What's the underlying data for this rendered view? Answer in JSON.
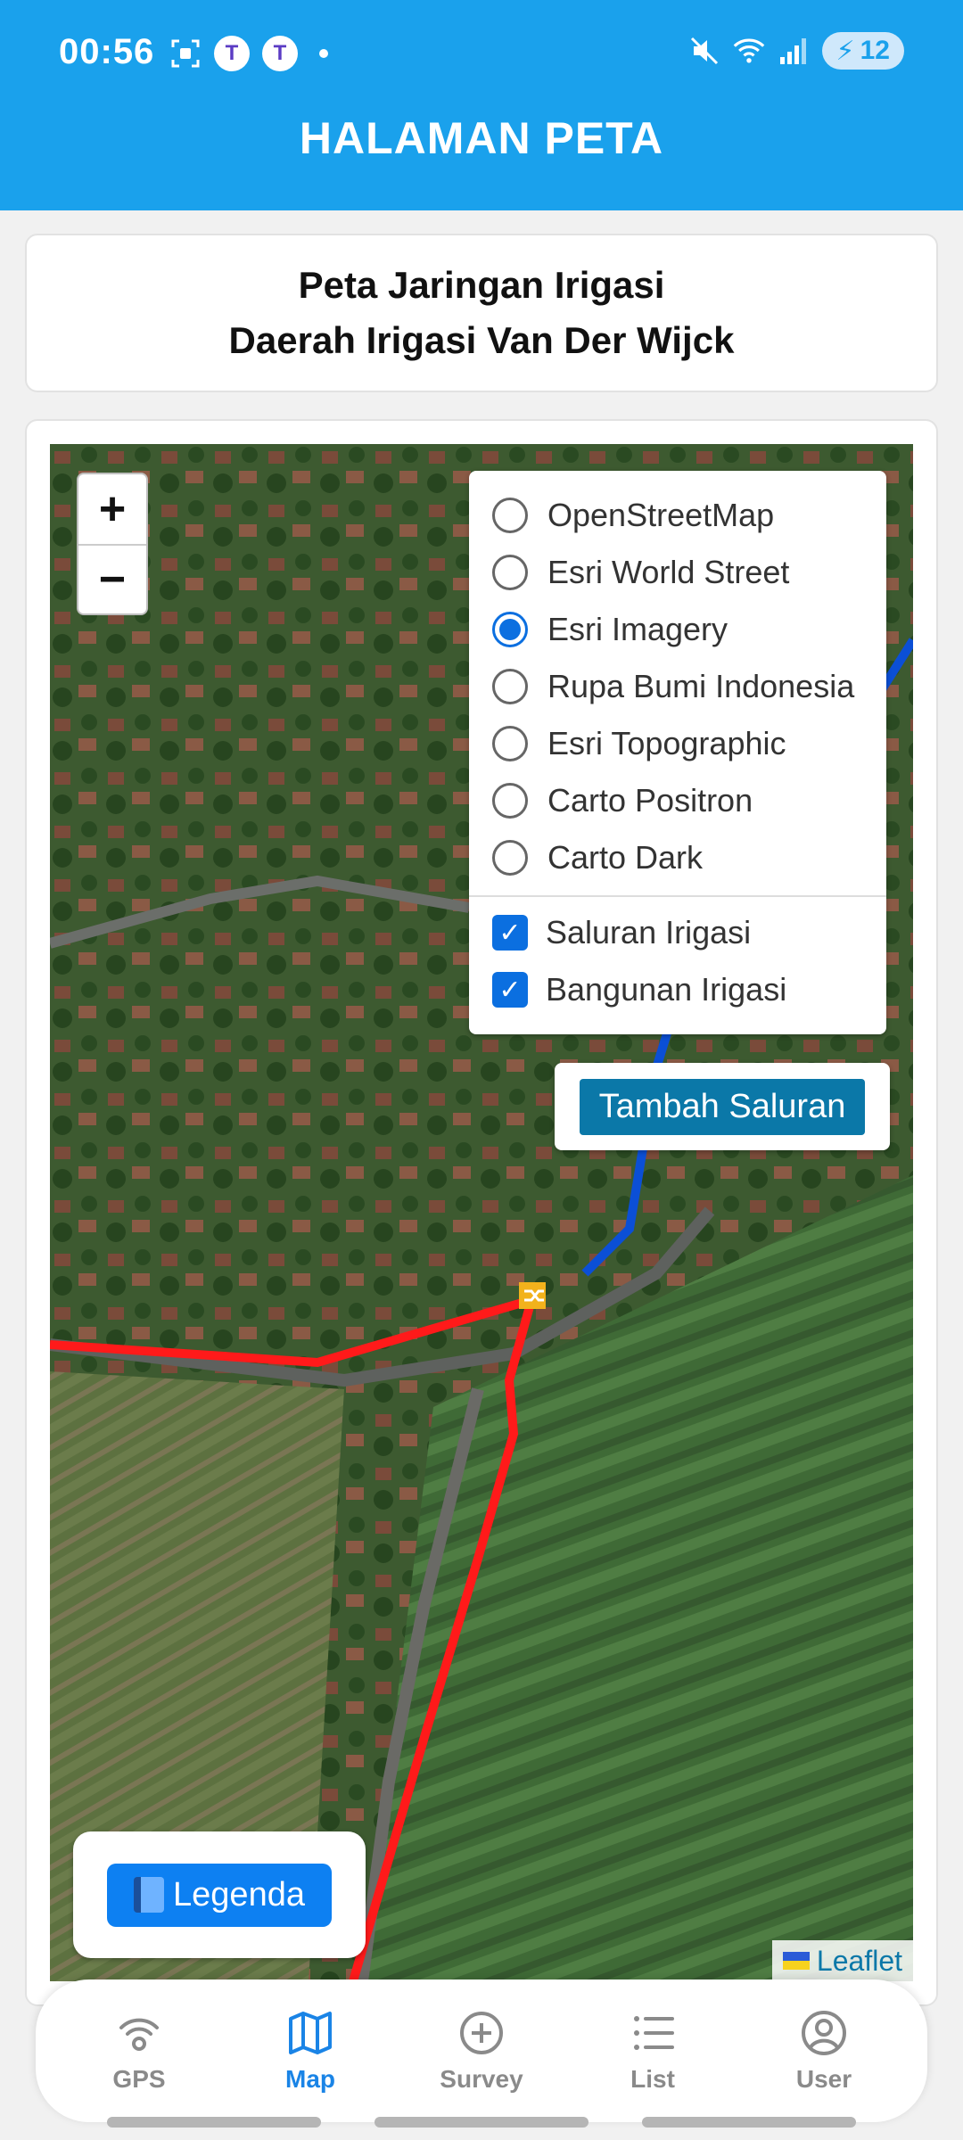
{
  "status": {
    "time": "00:56",
    "battery": "12"
  },
  "header": {
    "title": "HALAMAN PETA"
  },
  "title_card": {
    "line1": "Peta Jaringan Irigasi",
    "line2": "Daerah Irigasi Van Der Wijck"
  },
  "map": {
    "zoom_in": "+",
    "zoom_out": "−",
    "base_layers": [
      {
        "label": "OpenStreetMap",
        "selected": false
      },
      {
        "label": "Esri World Street",
        "selected": false
      },
      {
        "label": "Esri Imagery",
        "selected": true
      },
      {
        "label": "Rupa Bumi Indonesia",
        "selected": false
      },
      {
        "label": "Esri Topographic",
        "selected": false
      },
      {
        "label": "Carto Positron",
        "selected": false
      },
      {
        "label": "Carto Dark",
        "selected": false
      }
    ],
    "overlays": [
      {
        "label": "Saluran Irigasi",
        "checked": true
      },
      {
        "label": "Bangunan Irigasi",
        "checked": true
      }
    ],
    "tambah_button": "Tambah Saluran",
    "legenda_button": "Legenda",
    "attribution": "Leaflet",
    "colors": {
      "saluran": "#ff1a1a",
      "saluran_blue": "#0b4fd6"
    }
  },
  "bottom_nav": {
    "items": [
      {
        "label": "GPS",
        "icon": "gps-icon",
        "active": false
      },
      {
        "label": "Map",
        "icon": "map-icon",
        "active": true
      },
      {
        "label": "Survey",
        "icon": "plus-circle-icon",
        "active": false
      },
      {
        "label": "List",
        "icon": "list-icon",
        "active": false
      },
      {
        "label": "User",
        "icon": "user-icon",
        "active": false
      }
    ]
  }
}
